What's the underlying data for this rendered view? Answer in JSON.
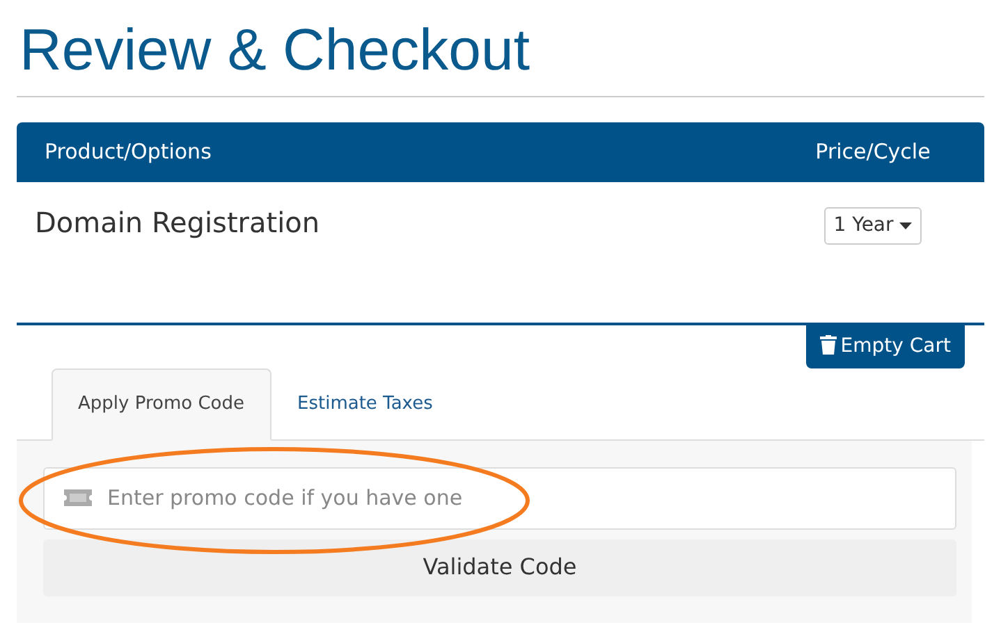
{
  "page_title": "Review & Checkout",
  "cart_table": {
    "columns": [
      "Product/Options",
      "Price/Cycle"
    ],
    "rows": [
      {
        "product": "Domain Registration",
        "cycle": "1 Year"
      }
    ]
  },
  "empty_cart_button": "Empty Cart",
  "tabs": [
    {
      "label": "Apply Promo Code",
      "selected": true
    },
    {
      "label": "Estimate Taxes",
      "selected": false
    }
  ],
  "promo_field": {
    "placeholder": "Enter promo code if you have one",
    "highlighted": true
  },
  "validate_button": "Validate Code"
}
